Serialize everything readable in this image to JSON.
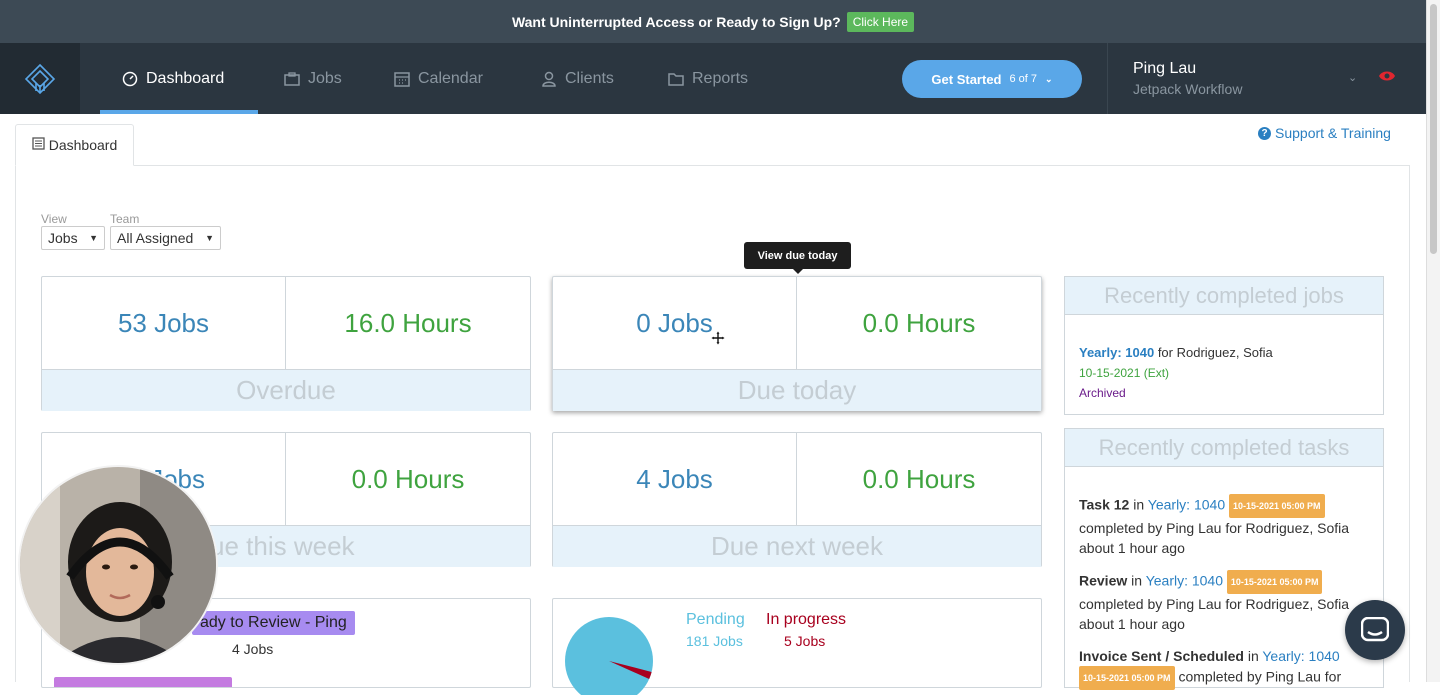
{
  "banner": {
    "message": "Want Uninterrupted Access or Ready to Sign Up?",
    "cta": "Click Here"
  },
  "nav": {
    "items": [
      {
        "label": "Dashboard",
        "icon": "dashboard-gauge-icon"
      },
      {
        "label": "Jobs",
        "icon": "briefcase-icon"
      },
      {
        "label": "Calendar",
        "icon": "calendar-icon"
      },
      {
        "label": "Clients",
        "icon": "user-icon"
      },
      {
        "label": "Reports",
        "icon": "folder-icon"
      }
    ],
    "get_started": {
      "label": "Get Started",
      "progress": "6 of 7"
    },
    "user": {
      "name": "Ping Lau",
      "org": "Jetpack Workflow"
    }
  },
  "tab": {
    "label": "Dashboard"
  },
  "support": {
    "label": "Support & Training"
  },
  "filters": {
    "view": {
      "label": "View",
      "value": "Jobs"
    },
    "team": {
      "label": "Team",
      "value": "All Assigned"
    }
  },
  "tooltip": "View due today",
  "stats": [
    {
      "jobs": "53 Jobs",
      "hours": "16.0 Hours",
      "label": "Overdue"
    },
    {
      "jobs": "0 Jobs",
      "hours": "0.0 Hours",
      "label": "Due today"
    },
    {
      "jobs": "Jobs",
      "hours": "0.0 Hours",
      "label": "ue this week"
    },
    {
      "jobs": "4 Jobs",
      "hours": "0.0 Hours",
      "label": "Due next week"
    }
  ],
  "recent_jobs": {
    "title": "Recently completed jobs",
    "job_link": "Yearly: 1040",
    "for_text": "for Rodriguez, Sofia",
    "date": "10-15-2021 (Ext)",
    "status": "Archived"
  },
  "recent_tasks": {
    "title": "Recently completed tasks",
    "items": [
      {
        "name": "Task 12",
        "in": "in",
        "job": "Yearly: 1040",
        "badge": "10-15-2021 05:00 PM",
        "completed": "completed by Ping Lau for Rodriguez, Sofia",
        "ago": "about 1 hour ago"
      },
      {
        "name": "Review",
        "in": "in",
        "job": "Yearly: 1040",
        "badge": "10-15-2021 05:00 PM",
        "completed": "completed by Ping Lau for Rodriguez, Sofia",
        "ago": "about 1 hour ago"
      },
      {
        "name": "Invoice Sent / Scheduled",
        "in": "in",
        "job": "Yearly: 1040",
        "badge": "10-15-2021 05:00 PM",
        "completed": "completed by Ping Lau for"
      }
    ]
  },
  "bottom_left": {
    "badge": "ady to Review - Ping",
    "count": "4 Jobs"
  },
  "bottom_mid": {
    "pending_label": "Pending",
    "pending_count": "181 Jobs",
    "progress_label": "In progress",
    "progress_count": "5 Jobs"
  },
  "pie": {
    "pending": 181,
    "in_progress": 5
  },
  "colors": {
    "pending": "#5bc0de",
    "in_progress": "#a8001e",
    "accent": "#5aa7e8"
  }
}
